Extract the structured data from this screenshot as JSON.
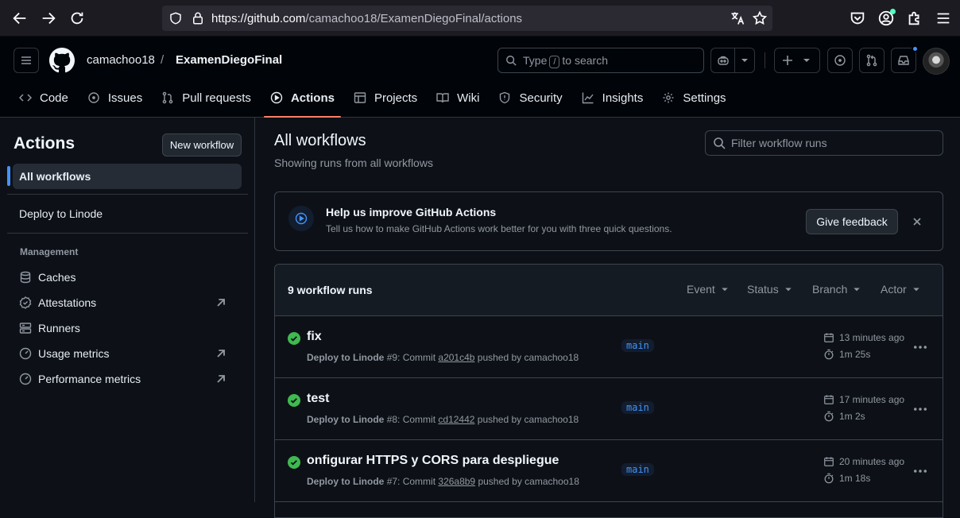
{
  "browser": {
    "url_domain": "https://github.com",
    "url_path": "/camachoo18/ExamenDiegoFinal/actions"
  },
  "header": {
    "owner": "camachoo18",
    "separator": "/",
    "repo": "ExamenDiegoFinal",
    "search_prefix": "Type",
    "search_key": "/",
    "search_suffix": "to search"
  },
  "tabs": [
    {
      "label": "Code"
    },
    {
      "label": "Issues"
    },
    {
      "label": "Pull requests"
    },
    {
      "label": "Actions"
    },
    {
      "label": "Projects"
    },
    {
      "label": "Wiki"
    },
    {
      "label": "Security"
    },
    {
      "label": "Insights"
    },
    {
      "label": "Settings"
    }
  ],
  "sidebar": {
    "title": "Actions",
    "new_workflow": "New workflow",
    "all_workflows": "All workflows",
    "workflow": "Deploy to Linode",
    "management_heading": "Management",
    "management": [
      {
        "label": "Caches"
      },
      {
        "label": "Attestations"
      },
      {
        "label": "Runners"
      },
      {
        "label": "Usage metrics"
      },
      {
        "label": "Performance metrics"
      }
    ]
  },
  "main": {
    "title": "All workflows",
    "subtitle": "Showing runs from all workflows",
    "filter_placeholder": "Filter workflow runs"
  },
  "feedback": {
    "title": "Help us improve GitHub Actions",
    "text": "Tell us how to make GitHub Actions work better for you with three quick questions.",
    "button": "Give feedback"
  },
  "runs": {
    "count": "9 workflow runs",
    "filters": [
      "Event",
      "Status",
      "Branch",
      "Actor"
    ],
    "items": [
      {
        "title": "fix",
        "workflow": "Deploy to Linode",
        "num": "#9: Commit",
        "sha": "a201c4b",
        "pushed": "pushed by camachoo18",
        "branch": "main",
        "ago": "13 minutes ago",
        "duration": "1m 25s"
      },
      {
        "title": "test",
        "workflow": "Deploy to Linode",
        "num": "#8: Commit",
        "sha": "cd12442",
        "pushed": "pushed by camachoo18",
        "branch": "main",
        "ago": "17 minutes ago",
        "duration": "1m 2s"
      },
      {
        "title": "onfigurar HTTPS y CORS para despliegue",
        "workflow": "Deploy to Linode",
        "num": "#7: Commit",
        "sha": "326a8b9",
        "pushed": "pushed by camachoo18",
        "branch": "main",
        "ago": "20 minutes ago",
        "duration": "1m 18s"
      }
    ]
  },
  "colors": {
    "accent": "#f78166",
    "success": "#3fb950",
    "link": "#4493f8",
    "bg": "#0d1117"
  }
}
